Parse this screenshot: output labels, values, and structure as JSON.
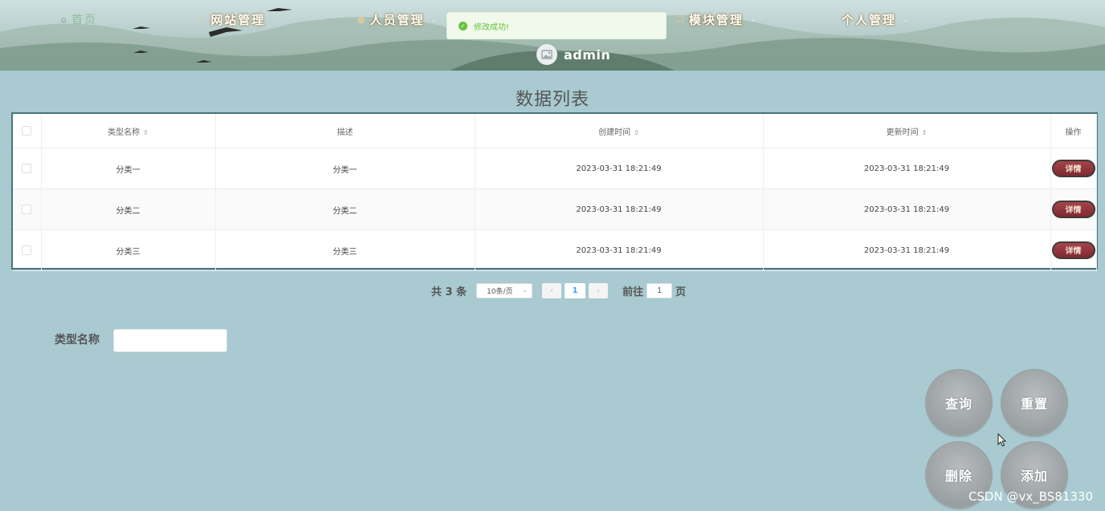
{
  "nav": {
    "items": [
      {
        "label": "首页",
        "icon": "home-icon"
      },
      {
        "label": "网站管理",
        "icon": "monitor-icon"
      },
      {
        "label": "人员管理",
        "icon": "user-icon"
      },
      {
        "label": "模块管理",
        "icon": "copy-icon"
      },
      {
        "label": "个人管理",
        "icon": "none"
      }
    ],
    "user": {
      "name": "admin",
      "avatar_icon": "image-icon"
    }
  },
  "toast": {
    "text": "修改成功!",
    "icon": "check-circle-icon",
    "color": "#67c23a"
  },
  "page_title": "数据列表",
  "table": {
    "columns": [
      "类型名称",
      "描述",
      "创建时间",
      "更新时间",
      "操作"
    ],
    "rows": [
      {
        "name": "分类一",
        "desc": "分类一",
        "created": "2023-03-31 18:21:49",
        "updated": "2023-03-31 18:21:49",
        "action": "详情"
      },
      {
        "name": "分类二",
        "desc": "分类二",
        "created": "2023-03-31 18:21:49",
        "updated": "2023-03-31 18:21:49",
        "action": "详情"
      },
      {
        "name": "分类三",
        "desc": "分类三",
        "created": "2023-03-31 18:21:49",
        "updated": "2023-03-31 18:21:49",
        "action": "详情"
      }
    ]
  },
  "pagination": {
    "total_label": "共 3 条",
    "page_size": "10条/页",
    "current_page": "1",
    "goto_prefix": "前往",
    "goto_value": "1",
    "goto_suffix": "页"
  },
  "search": {
    "label": "类型名称",
    "value": ""
  },
  "actions": {
    "query": "查询",
    "reset": "重置",
    "delete": "删除",
    "add": "添加"
  },
  "watermark": "CSDN @vx_BS81330",
  "colors": {
    "background": "#a8cad0",
    "detail_button": "#8f3a40",
    "table_border": "#4a7478"
  }
}
